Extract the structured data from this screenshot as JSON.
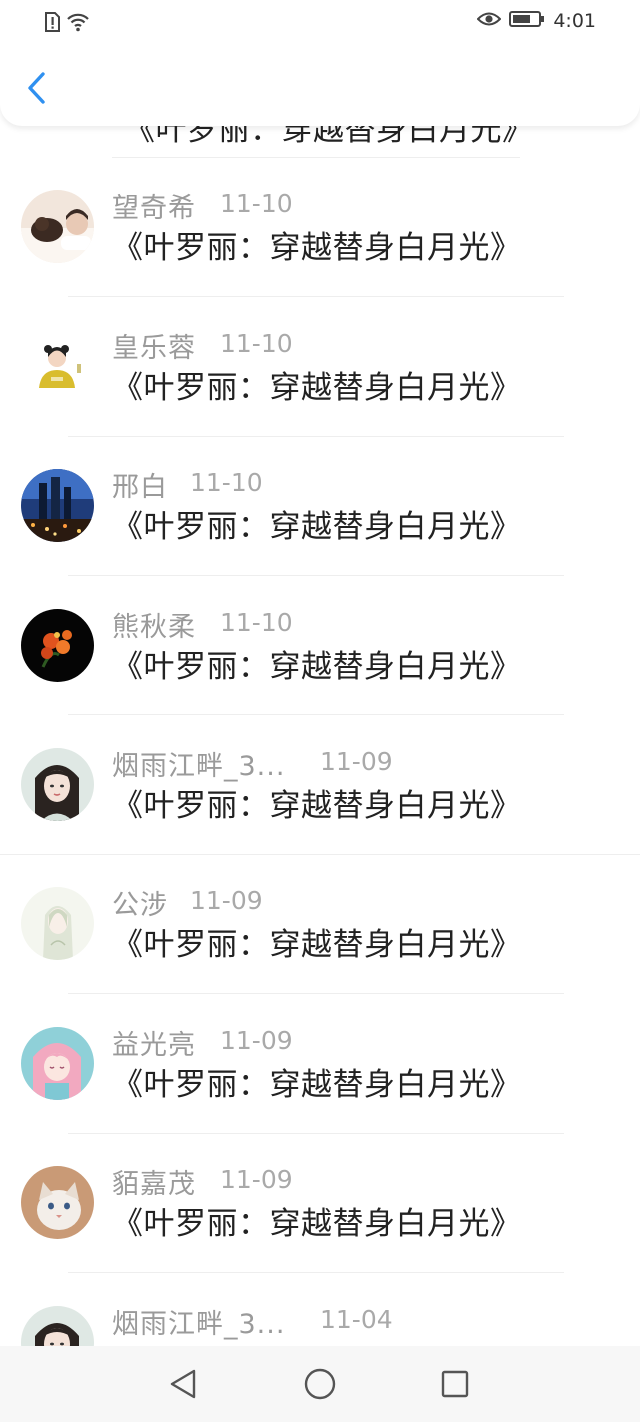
{
  "status_bar": {
    "time": "4:01",
    "icons": [
      "alert-icon",
      "wifi-icon",
      "eye-icon",
      "battery-icon"
    ]
  },
  "header": {
    "back_icon": "chevron-left-icon",
    "accent": "#2f90f0"
  },
  "peek_item": {
    "title": "《叶罗丽：穿越替身白月光》"
  },
  "items": [
    {
      "name": "望奇希",
      "date": "11-10",
      "title": "《叶罗丽：穿越替身白月光》"
    },
    {
      "name": "皇乐蓉",
      "date": "11-10",
      "title": "《叶罗丽：穿越替身白月光》"
    },
    {
      "name": "邢白",
      "date": "11-10",
      "title": "《叶罗丽：穿越替身白月光》"
    },
    {
      "name": "熊秋柔",
      "date": "11-10",
      "title": "《叶罗丽：穿越替身白月光》"
    },
    {
      "name": "烟雨江畔_3...",
      "date": "11-09",
      "title": "《叶罗丽：穿越替身白月光》"
    },
    {
      "name": "公涉",
      "date": "11-09",
      "title": "《叶罗丽：穿越替身白月光》"
    },
    {
      "name": "益光亮",
      "date": "11-09",
      "title": "《叶罗丽：穿越替身白月光》"
    },
    {
      "name": "貊嘉茂",
      "date": "11-09",
      "title": "《叶罗丽：穿越替身白月光》"
    },
    {
      "name": "烟雨江畔_3...",
      "date": "11-04",
      "title": ""
    }
  ],
  "nav_bar": {
    "icons": [
      "back-triangle-icon",
      "home-circle-icon",
      "recents-square-icon"
    ]
  }
}
